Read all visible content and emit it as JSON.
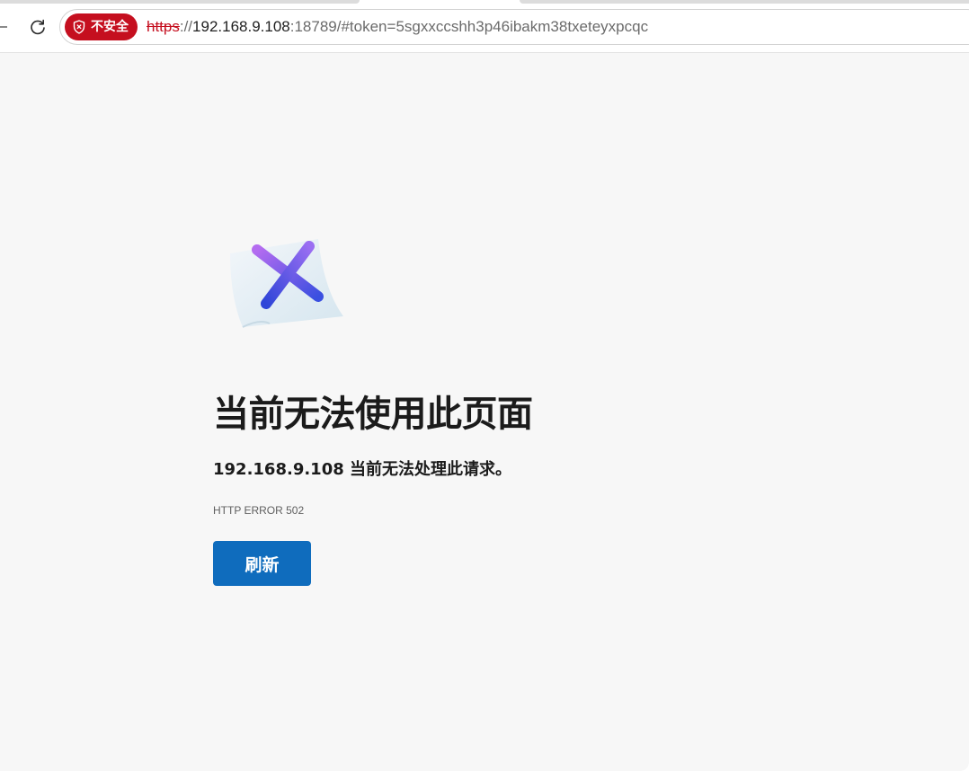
{
  "browser": {
    "security_badge": {
      "label": "不安全",
      "icon": "shield-alert-icon",
      "color": "#c50f1f"
    },
    "address": {
      "scheme": "https",
      "separator": "://",
      "host": "192.168.9.108",
      "rest": ":18789/#token=5sgxxccshh3p46ibakm38txeteyxpcqc"
    },
    "reload_icon": "reload-icon"
  },
  "error_page": {
    "illustration_icon": "page-error-x-icon",
    "title": "当前无法使用此页面",
    "description": "192.168.9.108 当前无法处理此请求。",
    "error_code": "HTTP ERROR 502",
    "refresh_label": "刷新",
    "accent_color": "#0f6cbd"
  }
}
